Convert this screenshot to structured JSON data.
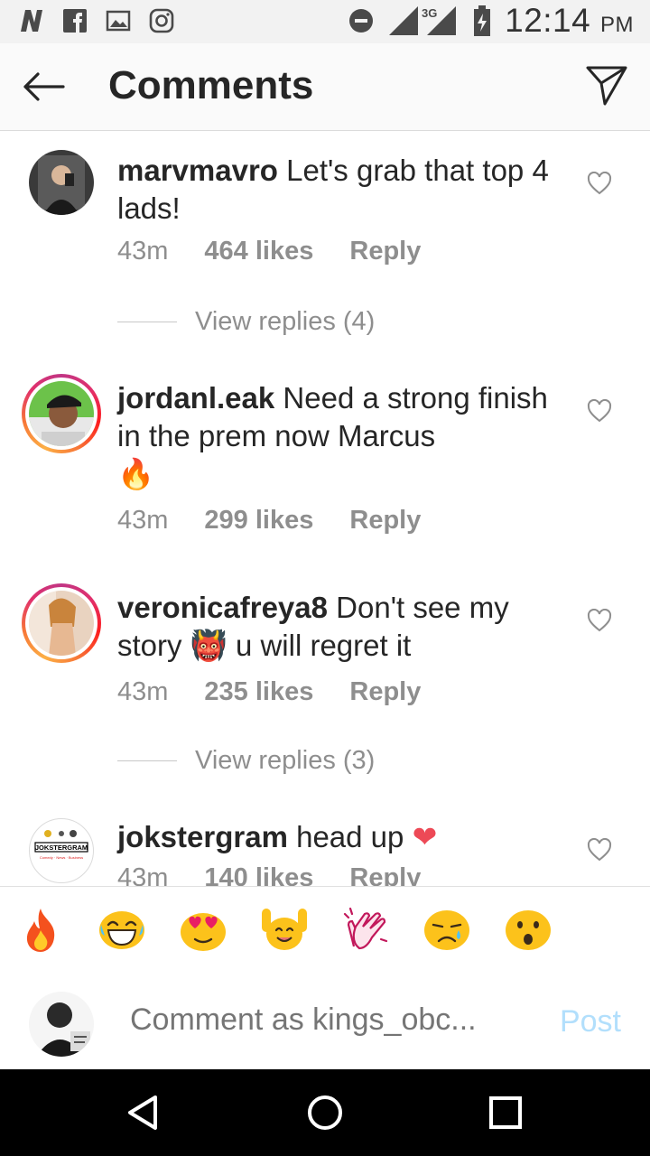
{
  "status_bar": {
    "time": "12:14",
    "ampm": "PM",
    "network": "3G",
    "left_icons": [
      "n-icon",
      "facebook-icon",
      "image-icon",
      "instagram-icon"
    ],
    "right_icons": [
      "dnd-icon",
      "signal-icon",
      "battery-icon"
    ]
  },
  "header": {
    "title": "Comments"
  },
  "comments": [
    {
      "username": "marvmavro",
      "text": "Let's grab that top 4 lads!",
      "time": "43m",
      "likes": "464 likes",
      "reply": "Reply",
      "view_replies": "View replies (4)"
    },
    {
      "username": "jordanl.eak",
      "text": "Need a strong finish in the prem now Marcus",
      "emoji": "🔥",
      "time": "43m",
      "likes": "299 likes",
      "reply": "Reply"
    },
    {
      "username": "veronicafreya8",
      "text": "Don't see my story",
      "emoji": "👹",
      "text2": "u will regret it",
      "time": "43m",
      "likes": "235 likes",
      "reply": "Reply",
      "view_replies": "View replies (3)"
    },
    {
      "username": "jokstergram",
      "text": "head up",
      "emoji": "❤",
      "time": "43m",
      "likes": "140 likes",
      "reply": "Reply",
      "avatar_text": "JOKSTERGRAM",
      "avatar_sub": "Comedy · News · Business"
    }
  ],
  "emoji_bar": [
    "🔥",
    "😂",
    "😍",
    "🙌",
    "👏",
    "😢",
    "😮"
  ],
  "composer": {
    "placeholder": "Comment as kings_obc...",
    "post_label": "Post"
  },
  "colors": {
    "accent_blue_disabled": "#b2dffc",
    "meta_gray": "#8e8e8e",
    "heart_red": "#ed4956"
  }
}
